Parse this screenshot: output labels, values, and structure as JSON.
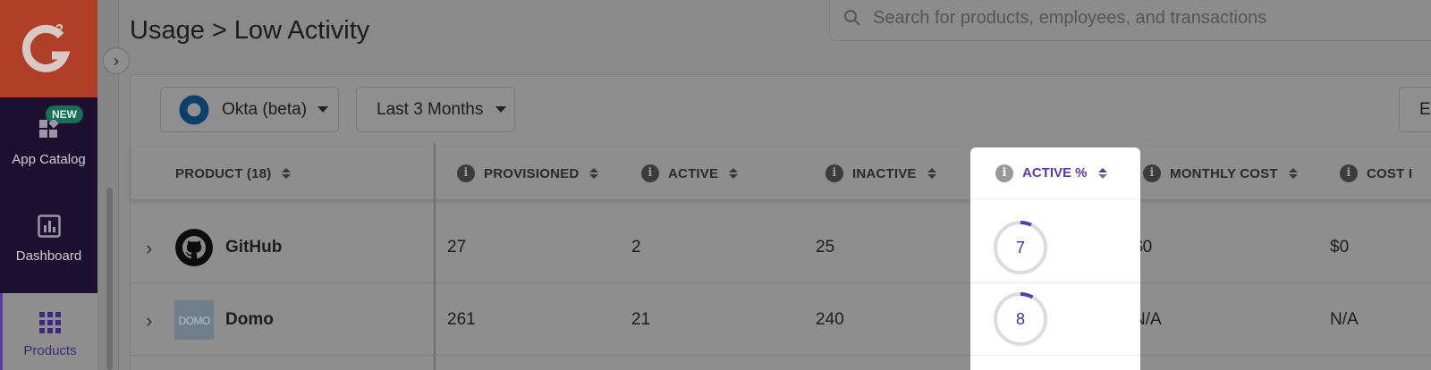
{
  "sidebar": {
    "new_badge": "NEW",
    "items": [
      {
        "label": "App Catalog",
        "icon": "app-catalog-icon"
      },
      {
        "label": "Dashboard",
        "icon": "dashboard-icon"
      },
      {
        "label": "Products",
        "icon": "grid-icon",
        "active": true
      }
    ]
  },
  "header": {
    "breadcrumb": [
      "Usage",
      "Low Activity"
    ],
    "breadcrumb_sep": ">",
    "search_placeholder": "Search for products, employees, and transactions"
  },
  "filters": {
    "source": "Okta (beta)",
    "period": "Last 3 Months",
    "export_label": "Ex"
  },
  "table": {
    "columns": [
      {
        "label": "PRODUCT (18)",
        "info": false
      },
      {
        "label": "PROVISIONED",
        "info": true
      },
      {
        "label": "ACTIVE",
        "info": true
      },
      {
        "label": "INACTIVE",
        "info": true
      },
      {
        "label": "ACTIVE %",
        "info": true,
        "highlighted": true
      },
      {
        "label": "MONTHLY COST",
        "info": true
      },
      {
        "label": "COST I",
        "info": true
      }
    ],
    "rows": [
      {
        "product": "GitHub",
        "provisioned": "27",
        "active": "2",
        "inactive": "25",
        "active_pct": "7",
        "active_pct_value": 7,
        "monthly_cost": "$0",
        "cost_i": "$0"
      },
      {
        "product": "Domo",
        "provisioned": "261",
        "active": "21",
        "inactive": "240",
        "active_pct": "8",
        "active_pct_value": 8,
        "monthly_cost": "N/A",
        "cost_i": "N/A"
      }
    ]
  },
  "colors": {
    "accent": "#5a3aa8",
    "logo_bg": "#ff492c",
    "nav_bg": "#1d0f30",
    "overlay": "rgba(0,0,0,0.45)"
  }
}
